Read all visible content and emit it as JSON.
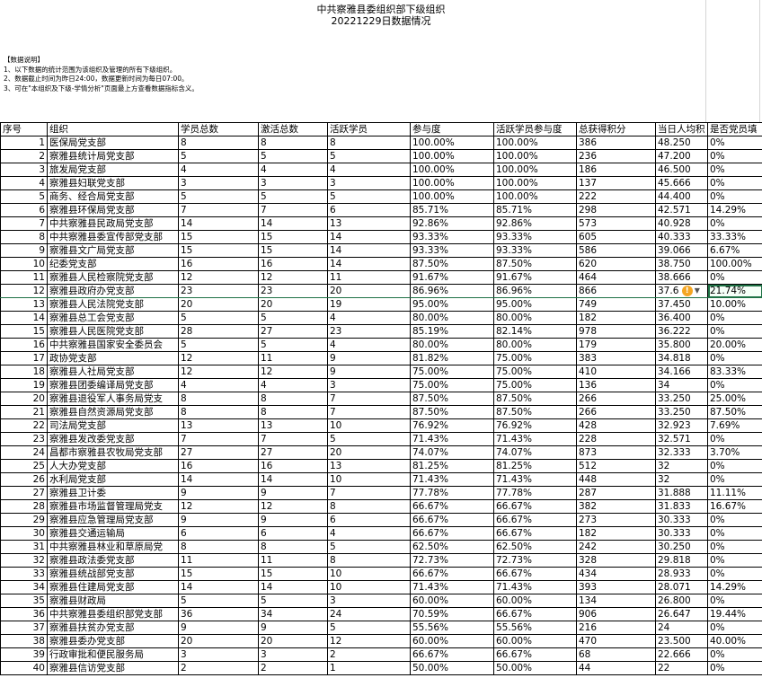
{
  "title": "中共察雅县委组织部下级组织",
  "subtitle": "20221229日数据情况",
  "notes": {
    "heading": "【数据说明】",
    "lines": [
      "1、以下数据的统计范围为该组织及管理的所有下级组织。",
      "2、数据截止时间为昨日24:00，数据更新时间为每日07:00。",
      "3、可在\"本组织及下级-学情分析\"页面最上方查看数据指标含义。"
    ]
  },
  "columns": [
    "序号",
    "组织",
    "学员总数",
    "激活总数",
    "活跃学员",
    "参与度",
    "活跃学员参与度",
    "总获得积分",
    "当日人均积",
    "是否党员填"
  ],
  "rows": [
    [
      "1",
      "医保局党支部",
      "8",
      "8",
      "8",
      "100.00%",
      "100.00%",
      "386",
      "48.250",
      "0%"
    ],
    [
      "2",
      "察雅县统计局党支部",
      "5",
      "5",
      "5",
      "100.00%",
      "100.00%",
      "236",
      "47.200",
      "0%"
    ],
    [
      "3",
      "旅发局党支部",
      "4",
      "4",
      "4",
      "100.00%",
      "100.00%",
      "186",
      "46.500",
      "0%"
    ],
    [
      "4",
      "察雅县妇联党支部",
      "3",
      "3",
      "3",
      "100.00%",
      "100.00%",
      "137",
      "45.666",
      "0%"
    ],
    [
      "5",
      "商务、经合局党支部",
      "5",
      "5",
      "5",
      "100.00%",
      "100.00%",
      "222",
      "44.400",
      "0%"
    ],
    [
      "6",
      "察雅县环保局党支部",
      "7",
      "7",
      "6",
      "85.71%",
      "85.71%",
      "298",
      "42.571",
      "14.29%"
    ],
    [
      "7",
      "中共察雅县民政局党支部",
      "14",
      "14",
      "13",
      "92.86%",
      "92.86%",
      "573",
      "40.928",
      "0%"
    ],
    [
      "8",
      "中共察雅县委宣传部党支部",
      "15",
      "15",
      "14",
      "93.33%",
      "93.33%",
      "605",
      "40.333",
      "33.33%"
    ],
    [
      "9",
      "察雅县文广局党支部",
      "15",
      "15",
      "14",
      "93.33%",
      "93.33%",
      "586",
      "39.066",
      "6.67%"
    ],
    [
      "10",
      "纪委党支部",
      "16",
      "16",
      "14",
      "87.50%",
      "87.50%",
      "620",
      "38.750",
      "100.00%"
    ],
    [
      "11",
      "察雅县人民检察院党支部",
      "12",
      "12",
      "11",
      "91.67%",
      "91.67%",
      "464",
      "38.666",
      "0%"
    ],
    [
      "12",
      "察雅县政府办党支部",
      "23",
      "23",
      "20",
      "86.96%",
      "86.96%",
      "866",
      "37.6",
      "21.74%"
    ],
    [
      "13",
      "察雅县人民法院党支部",
      "20",
      "20",
      "19",
      "95.00%",
      "95.00%",
      "749",
      "37.450",
      "10.00%"
    ],
    [
      "14",
      "察雅县总工会党支部",
      "5",
      "5",
      "4",
      "80.00%",
      "80.00%",
      "182",
      "36.400",
      "0%"
    ],
    [
      "15",
      "察雅县人民医院党支部",
      "28",
      "27",
      "23",
      "85.19%",
      "82.14%",
      "978",
      "36.222",
      "0%"
    ],
    [
      "16",
      "中共察雅县国家安全委员会",
      "5",
      "5",
      "4",
      "80.00%",
      "80.00%",
      "179",
      "35.800",
      "20.00%"
    ],
    [
      "17",
      "政协党支部",
      "12",
      "11",
      "9",
      "81.82%",
      "75.00%",
      "383",
      "34.818",
      "0%"
    ],
    [
      "18",
      "察雅县人社局党支部",
      "12",
      "12",
      "9",
      "75.00%",
      "75.00%",
      "410",
      "34.166",
      "83.33%"
    ],
    [
      "19",
      "察雅县团委编译局党支部",
      "4",
      "4",
      "3",
      "75.00%",
      "75.00%",
      "136",
      "34",
      "0%"
    ],
    [
      "20",
      "察雅县退役军人事务局党支",
      "8",
      "8",
      "7",
      "87.50%",
      "87.50%",
      "266",
      "33.250",
      "25.00%"
    ],
    [
      "21",
      "察雅县自然资源局党支部",
      "8",
      "8",
      "7",
      "87.50%",
      "87.50%",
      "266",
      "33.250",
      "87.50%"
    ],
    [
      "22",
      "司法局党支部",
      "13",
      "13",
      "10",
      "76.92%",
      "76.92%",
      "428",
      "32.923",
      "7.69%"
    ],
    [
      "23",
      "察雅县发改委党支部",
      "7",
      "7",
      "5",
      "71.43%",
      "71.43%",
      "228",
      "32.571",
      "0%"
    ],
    [
      "24",
      "昌都市察雅县农牧局党支部",
      "27",
      "27",
      "20",
      "74.07%",
      "74.07%",
      "873",
      "32.333",
      "3.70%"
    ],
    [
      "25",
      "人大办党支部",
      "16",
      "16",
      "13",
      "81.25%",
      "81.25%",
      "512",
      "32",
      "0%"
    ],
    [
      "26",
      "水利局党支部",
      "14",
      "14",
      "10",
      "71.43%",
      "71.43%",
      "448",
      "32",
      "0%"
    ],
    [
      "27",
      "察雅县卫计委",
      "9",
      "9",
      "7",
      "77.78%",
      "77.78%",
      "287",
      "31.888",
      "11.11%"
    ],
    [
      "28",
      "察雅县市场监督管理局党支",
      "12",
      "12",
      "8",
      "66.67%",
      "66.67%",
      "382",
      "31.833",
      "16.67%"
    ],
    [
      "29",
      "察雅县应急管理局党支部",
      "9",
      "9",
      "6",
      "66.67%",
      "66.67%",
      "273",
      "30.333",
      "0%"
    ],
    [
      "30",
      "察雅县交通运输局",
      "6",
      "6",
      "4",
      "66.67%",
      "66.67%",
      "182",
      "30.333",
      "0%"
    ],
    [
      "31",
      "中共察雅县林业和草原局党",
      "8",
      "8",
      "5",
      "62.50%",
      "62.50%",
      "242",
      "30.250",
      "0%"
    ],
    [
      "32",
      "察雅县政法委党支部",
      "11",
      "11",
      "8",
      "72.73%",
      "72.73%",
      "328",
      "29.818",
      "0%"
    ],
    [
      "33",
      "察雅县统战部党支部",
      "15",
      "15",
      "10",
      "66.67%",
      "66.67%",
      "434",
      "28.933",
      "0%"
    ],
    [
      "34",
      "察雅县住建局党支部",
      "14",
      "14",
      "10",
      "71.43%",
      "71.43%",
      "393",
      "28.071",
      "14.29%"
    ],
    [
      "35",
      "察雅县财政局",
      "5",
      "5",
      "3",
      "60.00%",
      "60.00%",
      "134",
      "26.800",
      "0%"
    ],
    [
      "36",
      "中共察雅县委组织部党支部",
      "36",
      "34",
      "24",
      "70.59%",
      "66.67%",
      "906",
      "26.647",
      "19.44%"
    ],
    [
      "37",
      "察雅县扶贫办党支部",
      "9",
      "9",
      "5",
      "55.56%",
      "55.56%",
      "216",
      "24",
      "0%"
    ],
    [
      "38",
      "察雅县委办党支部",
      "20",
      "20",
      "12",
      "60.00%",
      "60.00%",
      "470",
      "23.500",
      "40.00%"
    ],
    [
      "39",
      "行政审批和便民服务局",
      "3",
      "3",
      "2",
      "66.67%",
      "66.67%",
      "68",
      "22.666",
      "0%"
    ],
    [
      "40",
      "察雅县信访党支部",
      "2",
      "2",
      "1",
      "50.00%",
      "50.00%",
      "44",
      "22",
      "0%"
    ]
  ],
  "active_row": 12,
  "warning_icon": "warning-icon",
  "accent_color": "#1e7145"
}
